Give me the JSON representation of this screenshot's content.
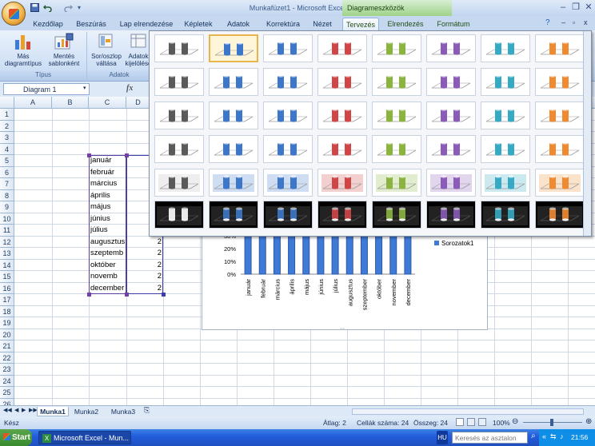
{
  "window": {
    "title": "Munkafüzet1 - Microsoft Excel",
    "context_group": "Diagrameszközök"
  },
  "tabs": [
    {
      "label": "Kezdőlap"
    },
    {
      "label": "Beszúrás"
    },
    {
      "label": "Lap elrendezése"
    },
    {
      "label": "Képletek"
    },
    {
      "label": "Adatok"
    },
    {
      "label": "Korrektúra"
    },
    {
      "label": "Nézet"
    },
    {
      "label": "Tervezés",
      "active": true
    },
    {
      "label": "Elrendezés"
    },
    {
      "label": "Formátum"
    }
  ],
  "ribbon": {
    "change_chart_type": "Más diagramtípus",
    "save_template": "Mentés sablonként",
    "group_type": "Típus",
    "switch_row_col": "Sor/oszlop váltása",
    "select_data": "Adatok kijelölése",
    "group_data": "Adatok"
  },
  "formula_bar": {
    "name_box": "Diagram 1",
    "fx": "fx"
  },
  "grid": {
    "columns": [
      "A",
      "B",
      "C",
      "D"
    ],
    "rows": [
      "1",
      "2",
      "3",
      "4",
      "5",
      "6",
      "7",
      "8",
      "9",
      "10",
      "11",
      "12",
      "13",
      "14",
      "15",
      "16",
      "17",
      "18",
      "19",
      "20",
      "21",
      "22",
      "23",
      "24",
      "25",
      "26"
    ],
    "months": [
      "január",
      "február",
      "március",
      "április",
      "május",
      "június",
      "július",
      "augusztus",
      "szeptemb",
      "október",
      "novemb",
      "december"
    ],
    "d_values": [
      "2",
      "2",
      "2",
      "2",
      "2",
      "2"
    ]
  },
  "chart_data": {
    "type": "bar",
    "categories": [
      "január",
      "február",
      "március",
      "április",
      "május",
      "június",
      "július",
      "augusztus",
      "szeptember",
      "október",
      "november",
      "december"
    ],
    "series": [
      {
        "name": "Sorozatok1",
        "values": [
          1,
          1,
          1,
          1,
          1,
          1,
          1,
          1,
          1,
          1,
          1,
          1
        ]
      }
    ],
    "y_ticks": [
      "30%",
      "20%",
      "10%",
      "0%"
    ],
    "legend": "right"
  },
  "gallery": {
    "colors": [
      "#6b6b6b",
      "#3c77c9",
      "#3c77c9",
      "#d04545",
      "#8bb43e",
      "#8a5bb8",
      "#36a9c4",
      "#ef8a30"
    ],
    "selected": "row0-col1"
  },
  "sheet_tabs": [
    "Munka1",
    "Munka2",
    "Munka3"
  ],
  "status": {
    "ready": "Kész",
    "average": "Átlag: 2",
    "count": "Cellák száma: 24",
    "sum": "Összeg: 24",
    "zoom": "100%"
  },
  "taskbar": {
    "start": "Start",
    "excel_task": "Microsoft Excel - Mun...",
    "lang": "HU",
    "search_placeholder": "Keresés az asztalon",
    "clock": "21:56"
  }
}
